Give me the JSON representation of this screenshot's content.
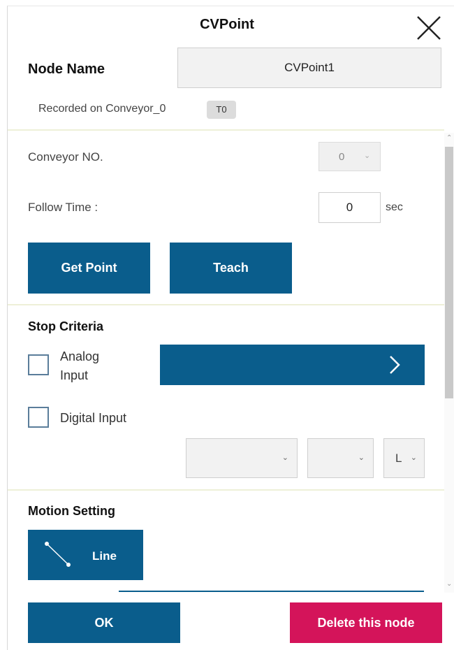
{
  "dialog": {
    "title": "CVPoint"
  },
  "node": {
    "label": "Node Name",
    "value": "CVPoint1",
    "recorded_text": "Recorded on Conveyor_0",
    "tag": "T0"
  },
  "conveyor": {
    "label": "Conveyor NO.",
    "value": "0"
  },
  "follow_time": {
    "label": "Follow Time :",
    "value": "0",
    "unit": "sec"
  },
  "buttons": {
    "get_point": "Get Point",
    "teach": "Teach",
    "ok": "OK",
    "delete": "Delete this node"
  },
  "stop_criteria": {
    "heading": "Stop Criteria",
    "analog_line1": "Analog",
    "analog_line2": "Input",
    "digital": "Digital Input",
    "dropdown3_value": "L"
  },
  "motion": {
    "heading": "Motion Setting",
    "line_label": "Line"
  },
  "colors": {
    "primary": "#0a5d8c",
    "danger": "#d4145a"
  }
}
